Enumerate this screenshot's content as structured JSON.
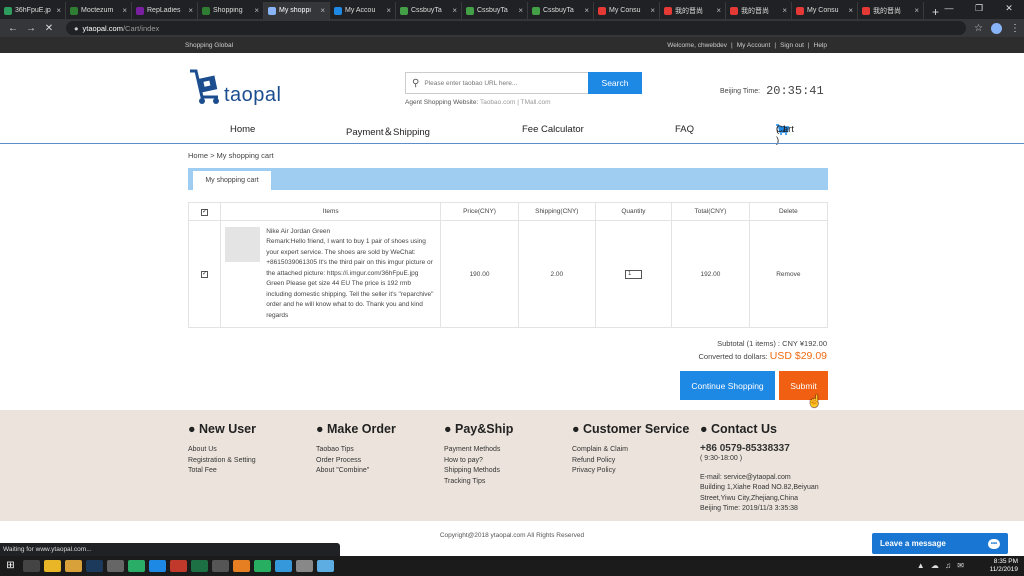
{
  "browser": {
    "tabs": [
      {
        "title": "36hFpuE.jp",
        "color": "#2e9c5c"
      },
      {
        "title": "Moctezum",
        "color": "#2e7d32"
      },
      {
        "title": "RepLadies",
        "color": "#7b1fa2"
      },
      {
        "title": "Shopping",
        "color": "#2e7d32"
      },
      {
        "title": "My shoppi",
        "color": "#8ab4f8",
        "active": true
      },
      {
        "title": "My Accou",
        "color": "#1e88e5"
      },
      {
        "title": "CssbuyTa",
        "color": "#43a047"
      },
      {
        "title": "CssbuyTa",
        "color": "#43a047"
      },
      {
        "title": "CssbuyTa",
        "color": "#43a047"
      },
      {
        "title": "My Consu",
        "color": "#e53935"
      },
      {
        "title": "我的晋尚",
        "color": "#e53935"
      },
      {
        "title": "我的晋尚",
        "color": "#e53935"
      },
      {
        "title": "My Consu",
        "color": "#e53935"
      },
      {
        "title": "我的晋尚",
        "color": "#e53935"
      }
    ],
    "new_tab": "+",
    "url_host": "ytaopal.com",
    "url_path": "/Cart/index",
    "status_text": "Waiting for www.ytaopal.com..."
  },
  "site": {
    "top_left": "Shopping Global",
    "top_links": [
      "Welcome, chwebdev",
      "|",
      "My Account",
      "|",
      "Sign out",
      "|",
      "Help"
    ],
    "logo_text": "taopal",
    "search_placeholder": "Please enter taobao URL here...",
    "search_button": "Search",
    "agent_label": "Agent Shopping Website:",
    "agent_sites": [
      "Taobao.com",
      "|",
      "TMall.com"
    ],
    "beijing_label": "Beijing Time:",
    "beijing_time": "20:35:41",
    "nav": [
      "Home",
      "Payment＆Shipping",
      "Fee Calculator",
      "FAQ"
    ],
    "cart_label": "Cart",
    "cart_count": "( 1 )"
  },
  "cart": {
    "breadcrumb": "Home > My shopping cart",
    "tab": "My shopping cart",
    "headers": [
      "Items",
      "Price(CNY)",
      "Shipping(CNY)",
      "Quantity",
      "Total(CNY)",
      "Delete"
    ],
    "item": {
      "name": "Nike Air Jordan Green",
      "remark": "Remark:Hello friend, I want to buy 1 pair of shoes using your expert service. The shoes are sold by WeChat: +8615039061305 It's the third pair on this imgur picture or the attached picture: https://i.imgur.com/36hFpuE.jpg Green Please get size 44 EU The price is 192 rmb including domestic shipping. Tell the seller it's \"reparchive\" order and he will know what to do. Thank you and kind regards",
      "price": "190.00",
      "shipping": "2.00",
      "quantity": "1",
      "total": "192.00",
      "remove": "Remove"
    },
    "subtotal": "Subtotal (1 items) : CNY ¥192.00",
    "converted_label": "Converted to dollars:",
    "converted_value": "USD $29.09",
    "continue_button": "Continue Shopping",
    "submit_button": "Submit"
  },
  "footer": {
    "new_user": {
      "title": "● New User",
      "links": [
        "About Us",
        "Registration & Setting",
        "Total Fee"
      ]
    },
    "make_order": {
      "title": "● Make Order",
      "links": [
        "Taobao Tips",
        "Order Process",
        "About \"Combine\""
      ]
    },
    "pay_ship": {
      "title": "● Pay&Ship",
      "links": [
        "Payment Methods",
        "How to pay?",
        "Shipping Methods",
        "Tracking Tips"
      ]
    },
    "customer_service": {
      "title": "● Customer Service",
      "links": [
        "Complain & Claim",
        "Refund Policy",
        "Privacy Policy"
      ]
    },
    "contact": {
      "title": "● Contact Us",
      "phone": "+86 0579-85338337",
      "hours": "( 9:30-18:00 )",
      "email": "E-mail: service@ytaopal.com",
      "address": "Building 1,Xiahe Road NO.82,Beiyuan Street,Yiwu City,Zhejiang,China",
      "time": "Beijing Time: 2019/11/3 3:35:38"
    },
    "copyright": "Copyright@2018 ytaopal.com All Rights Reserved",
    "leave_message": "Leave a message"
  },
  "taskbar": {
    "time": "8:35 PM",
    "date": "11/2/2019"
  }
}
